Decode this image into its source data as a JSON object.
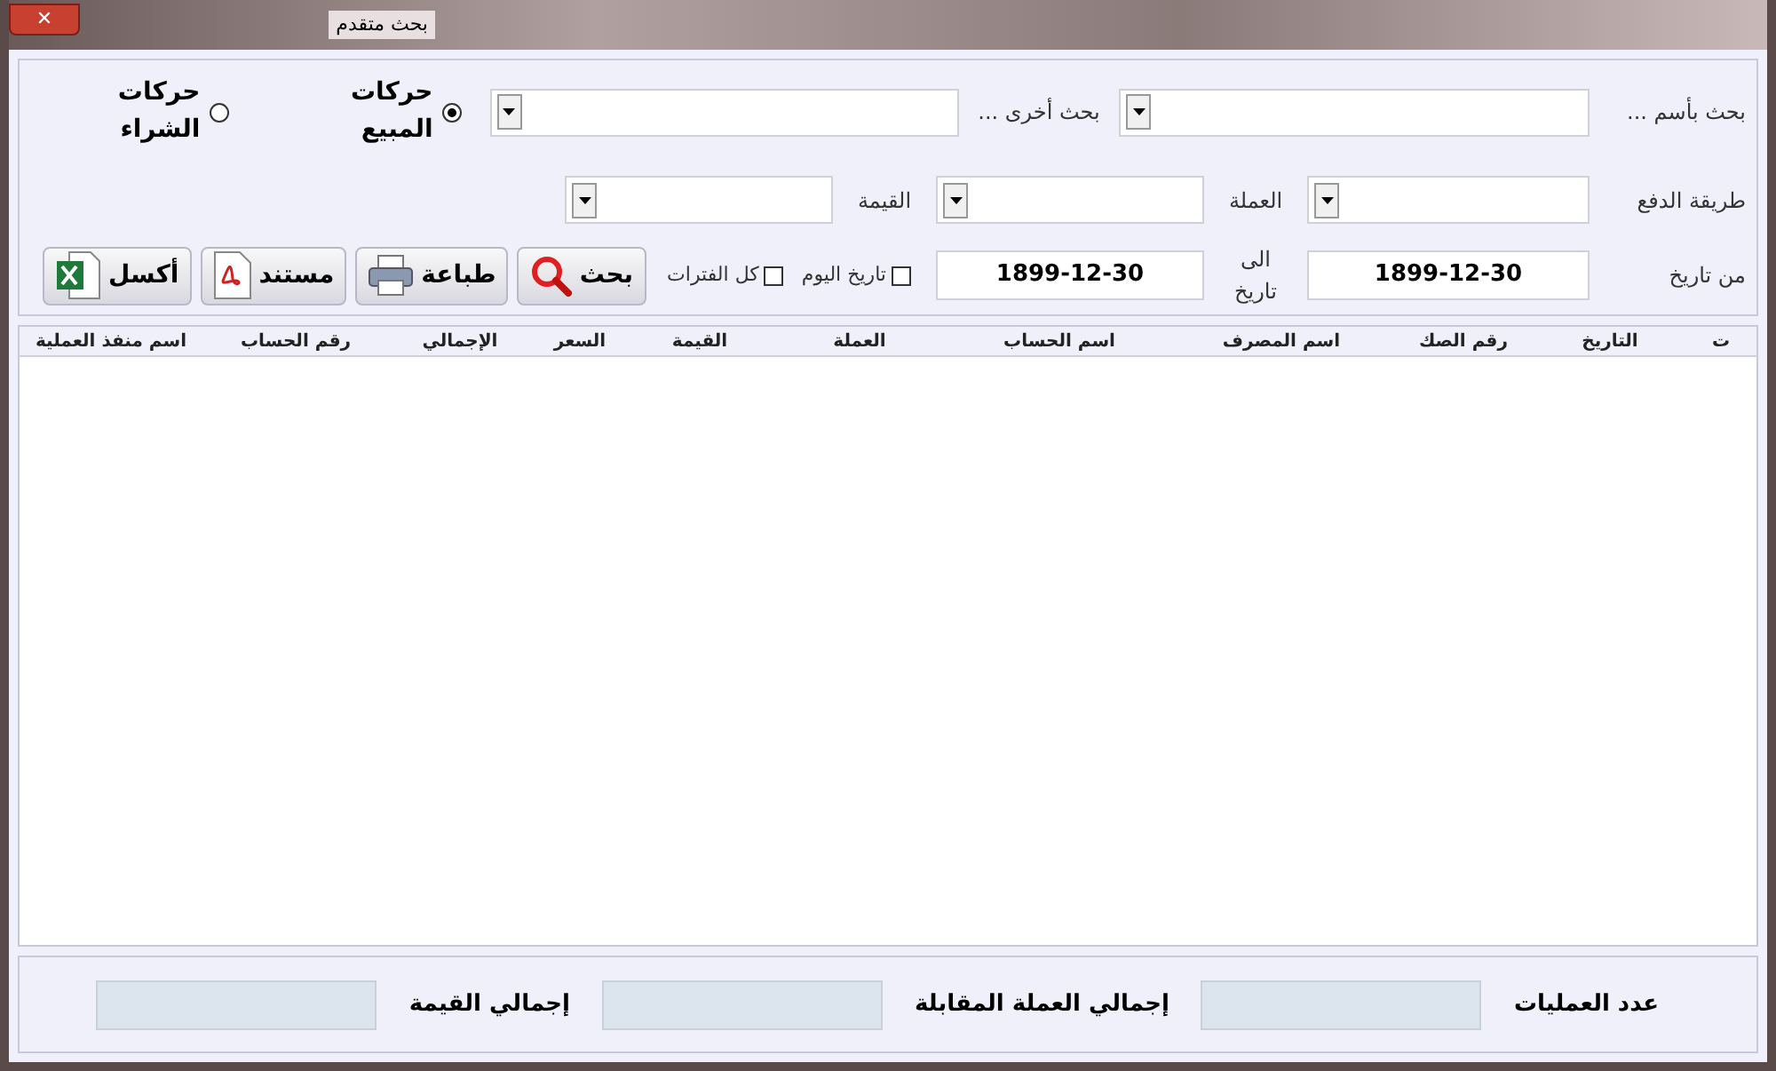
{
  "window": {
    "title": "بحث متقدم",
    "close": "✕"
  },
  "search": {
    "name_label": "بحث بأسم ...",
    "other_label": "بحث أخرى ..."
  },
  "movement_types": [
    {
      "label": "حركات المبيع",
      "selected": true
    },
    {
      "label": "حركات الشراء",
      "selected": false
    }
  ],
  "filters": [
    {
      "label": "طريقة الدفع"
    },
    {
      "label": "العملة"
    },
    {
      "label": "القيمة"
    }
  ],
  "dates": {
    "from_label": "من تاريخ",
    "from_value": "1899-12-30",
    "to_label": "الى تاريخ",
    "to_value": "1899-12-30"
  },
  "checkboxes": [
    {
      "label": "تاريخ اليوم",
      "checked": false
    },
    {
      "label": "كل الفترات",
      "checked": false
    }
  ],
  "buttons": [
    {
      "kind": "search",
      "label": "بحث"
    },
    {
      "kind": "print",
      "label": "طباعة"
    },
    {
      "kind": "pdf",
      "label": "مستند"
    },
    {
      "kind": "excel",
      "label": "أكسل"
    }
  ],
  "table": {
    "columns": [
      "ت",
      "التاريخ",
      "رقم الصك",
      "اسم المصرف",
      "اسم الحساب",
      "العملة",
      "القيمة",
      "السعر",
      "الإجمالي",
      "رقم الحساب",
      "اسم منفذ العملية"
    ]
  },
  "totals": [
    {
      "label": "عدد العمليات"
    },
    {
      "label": "إجمالي العملة المقابلة"
    },
    {
      "label": "إجمالي القيمة"
    }
  ]
}
